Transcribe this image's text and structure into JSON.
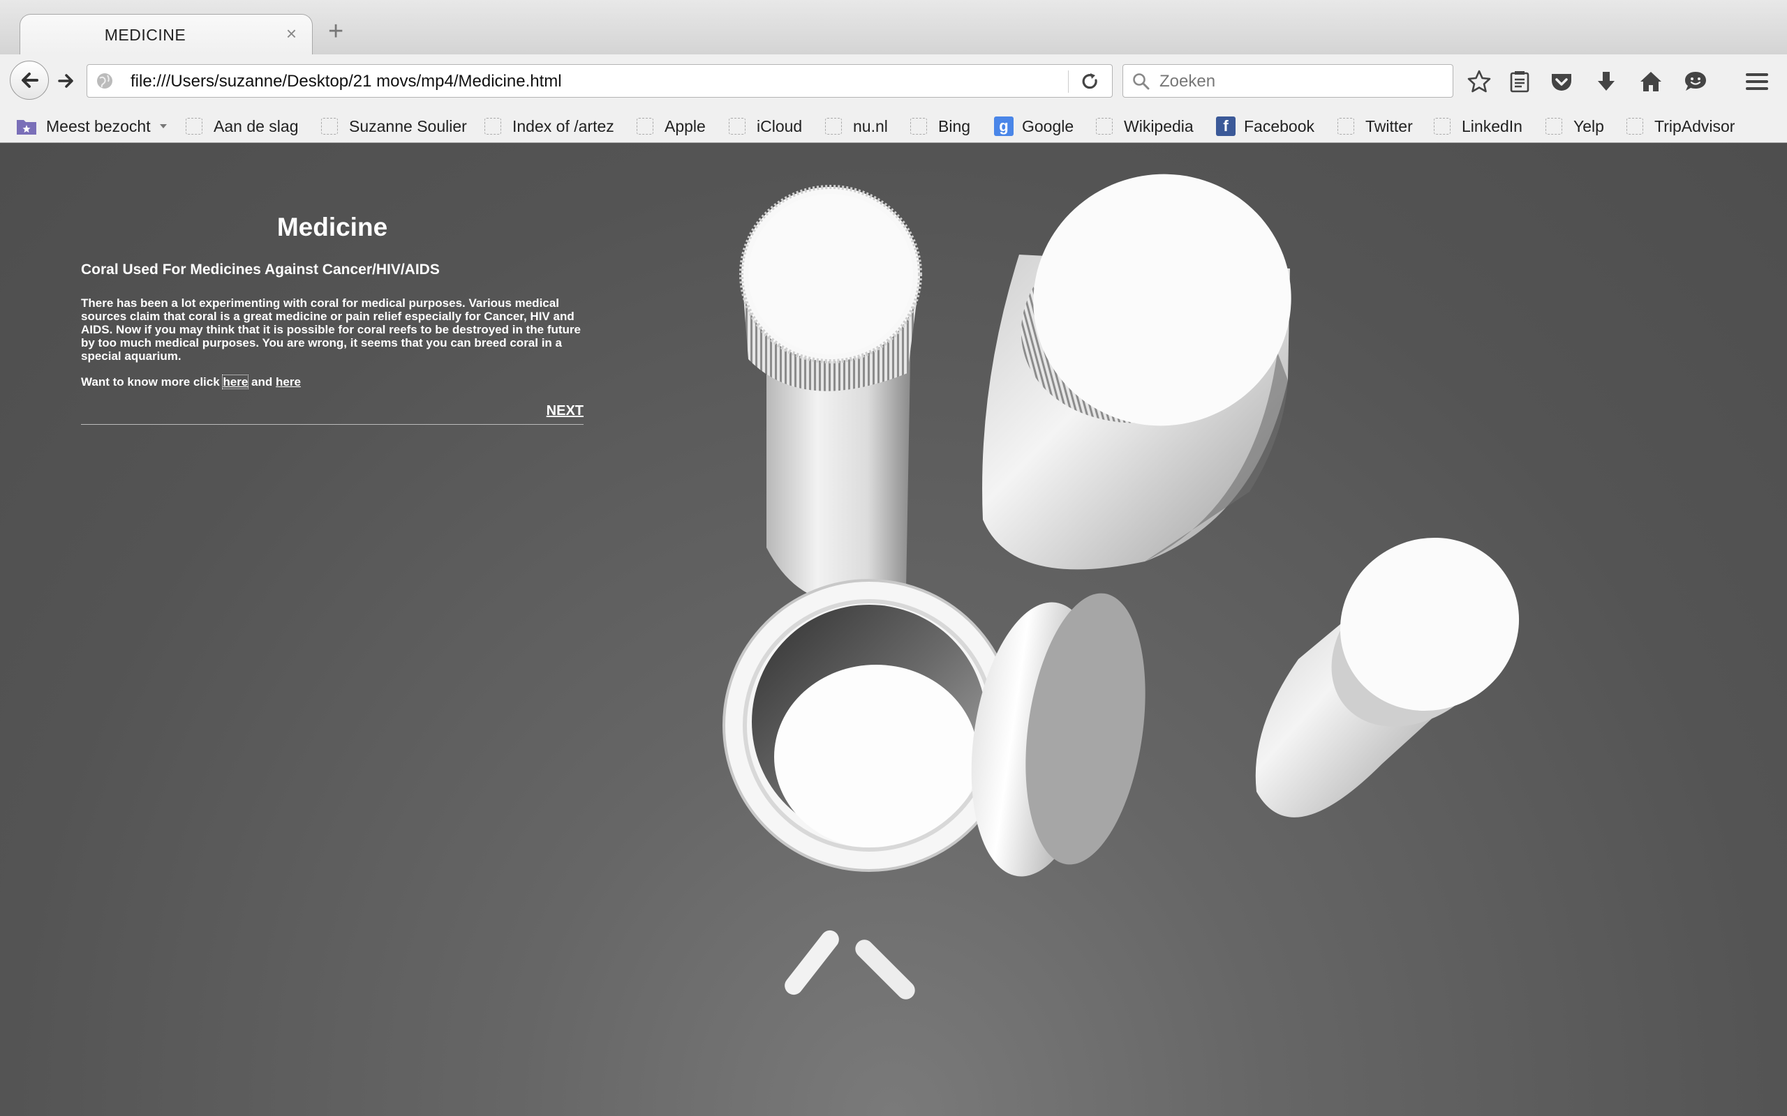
{
  "browser": {
    "tab_title": "MEDICINE",
    "tab_close": "×",
    "new_tab": "+",
    "url": "file:///Users/suzanne/Desktop/21 movs/mp4/Medicine.html",
    "search_placeholder": "Zoeken"
  },
  "bookmarks": [
    {
      "label": "Meest bezocht",
      "icon": "folder-icon"
    },
    {
      "label": "Aan de slag"
    },
    {
      "label": "Suzanne Soulier"
    },
    {
      "label": "Index of /artez"
    },
    {
      "label": "Apple"
    },
    {
      "label": "iCloud"
    },
    {
      "label": "nu.nl"
    },
    {
      "label": "Bing"
    },
    {
      "label": "Google",
      "icon": "google-icon"
    },
    {
      "label": "Wikipedia"
    },
    {
      "label": "Facebook",
      "icon": "facebook-icon"
    },
    {
      "label": "Twitter"
    },
    {
      "label": "LinkedIn"
    },
    {
      "label": "Yelp"
    },
    {
      "label": "TripAdvisor"
    }
  ],
  "content": {
    "title": "Medicine",
    "subtitle": "Coral Used For Medicines Against Cancer/HIV/AIDS",
    "body": "There has been a lot experimenting with coral for medical purposes. Various medical sources claim that coral is a great medicine or pain relief especially for Cancer, HIV and AIDS. Now if you may think that it is possible for coral reefs to be destroyed in the future by too much medical purposes. You are wrong, it seems that you can breed coral in a special aquarium.",
    "more_prefix": "Want to know more click ",
    "link1": "here",
    "more_middle": " and ",
    "link2": "here",
    "next": "NEXT"
  },
  "colors": {
    "page_bg": "#5a5a5a",
    "text": "#ffffff"
  }
}
